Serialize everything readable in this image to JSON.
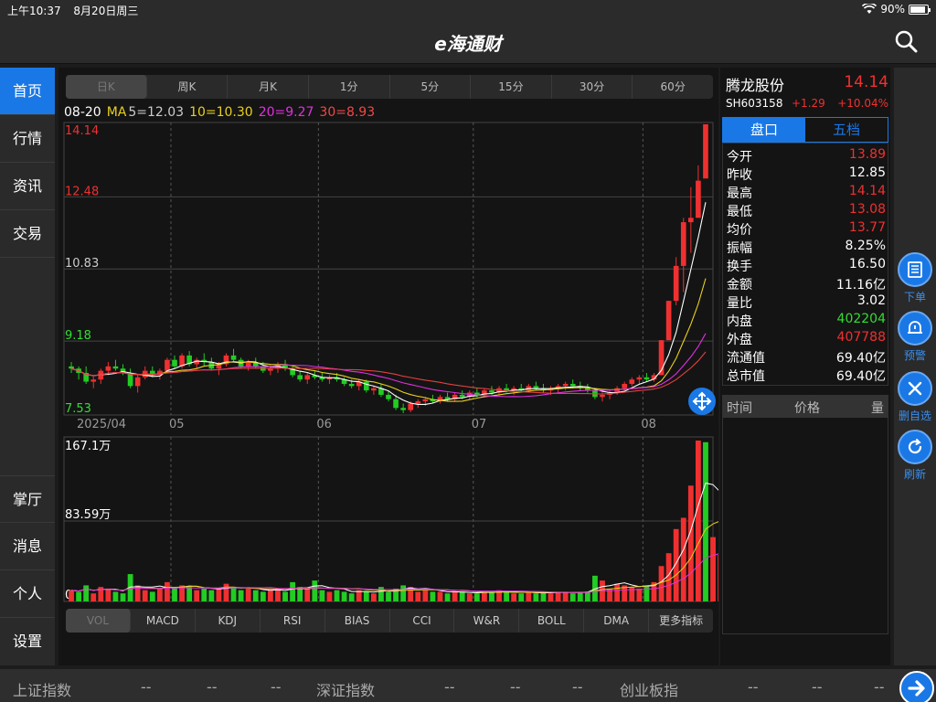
{
  "statusbar": {
    "time": "上午10:37",
    "date": "8月20日周三",
    "battery": "90%",
    "battery_level": 0.9
  },
  "app": {
    "title": "e海通财"
  },
  "leftnav": {
    "top_items": [
      {
        "label": "首页",
        "active": true
      },
      {
        "label": "行情",
        "active": false
      },
      {
        "label": "资讯",
        "active": false
      },
      {
        "label": "交易",
        "active": false
      }
    ],
    "bottom_items": [
      {
        "label": "掌厅"
      },
      {
        "label": "消息"
      },
      {
        "label": "个人"
      },
      {
        "label": "设置"
      }
    ]
  },
  "periods": [
    {
      "label": "日K",
      "active": true
    },
    {
      "label": "周K"
    },
    {
      "label": "月K"
    },
    {
      "label": "1分"
    },
    {
      "label": "5分"
    },
    {
      "label": "15分"
    },
    {
      "label": "30分"
    },
    {
      "label": "60分"
    }
  ],
  "ma_legend": {
    "date": "08-20",
    "ma": "MA",
    "ma5": "5=12.03",
    "ma10": "10=10.30",
    "ma20": "20=9.27",
    "ma30": "30=8.93"
  },
  "colors": {
    "up": "#f03030",
    "down": "#22cc22",
    "ma5": "#ffffff",
    "ma10": "#e8d020",
    "ma20": "#e030e0",
    "ma30": "#e04040",
    "accent": "#1a78e6",
    "label_green": "#33dd33"
  },
  "price_axis": {
    "labels": [
      "14.14",
      "12.48",
      "10.83",
      "9.18",
      "7.53"
    ]
  },
  "date_axis": {
    "labels": [
      "2025/04",
      "05",
      "06",
      "07",
      "08"
    ]
  },
  "volume_axis": {
    "labels": [
      "167.1万",
      "83.59万",
      "0"
    ]
  },
  "indicators": [
    {
      "label": "VOL",
      "active": true
    },
    {
      "label": "MACD"
    },
    {
      "label": "KDJ"
    },
    {
      "label": "RSI"
    },
    {
      "label": "BIAS"
    },
    {
      "label": "CCI"
    },
    {
      "label": "W&R"
    },
    {
      "label": "BOLL"
    },
    {
      "label": "DMA"
    },
    {
      "label": "更多指标"
    }
  ],
  "chart_data": {
    "type": "candlestick",
    "title": "",
    "price_range": [
      7.53,
      14.14
    ],
    "volume_range": [
      0,
      1671000
    ],
    "grid": true,
    "month_labels": [
      "2025/04",
      "05",
      "06",
      "07",
      "08"
    ],
    "candles": [
      [
        8.6,
        8.7,
        8.45,
        8.55
      ],
      [
        8.55,
        8.6,
        8.3,
        8.45
      ],
      [
        8.45,
        8.6,
        8.2,
        8.25
      ],
      [
        8.25,
        8.4,
        8.1,
        8.3
      ],
      [
        8.3,
        8.55,
        8.2,
        8.5
      ],
      [
        8.5,
        8.7,
        8.4,
        8.6
      ],
      [
        8.6,
        8.75,
        8.5,
        8.55
      ],
      [
        8.55,
        8.65,
        8.4,
        8.45
      ],
      [
        8.45,
        8.55,
        8.1,
        8.15
      ],
      [
        8.15,
        8.4,
        8.0,
        8.35
      ],
      [
        8.35,
        8.6,
        8.3,
        8.5
      ],
      [
        8.5,
        8.6,
        8.35,
        8.4
      ],
      [
        8.4,
        8.55,
        8.3,
        8.5
      ],
      [
        8.5,
        8.8,
        8.45,
        8.75
      ],
      [
        8.75,
        8.85,
        8.55,
        8.6
      ],
      [
        8.6,
        8.9,
        8.55,
        8.85
      ],
      [
        8.85,
        8.95,
        8.6,
        8.65
      ],
      [
        8.65,
        8.8,
        8.55,
        8.75
      ],
      [
        8.75,
        8.9,
        8.6,
        8.7
      ],
      [
        8.7,
        8.8,
        8.5,
        8.55
      ],
      [
        8.55,
        8.7,
        8.4,
        8.65
      ],
      [
        8.65,
        8.9,
        8.6,
        8.85
      ],
      [
        8.85,
        9.0,
        8.7,
        8.75
      ],
      [
        8.75,
        8.8,
        8.55,
        8.6
      ],
      [
        8.6,
        8.75,
        8.5,
        8.7
      ],
      [
        8.7,
        8.8,
        8.55,
        8.6
      ],
      [
        8.6,
        8.7,
        8.45,
        8.5
      ],
      [
        8.5,
        8.65,
        8.4,
        8.55
      ],
      [
        8.55,
        8.7,
        8.45,
        8.65
      ],
      [
        8.65,
        8.75,
        8.5,
        8.55
      ],
      [
        8.55,
        8.6,
        8.35,
        8.4
      ],
      [
        8.4,
        8.5,
        8.25,
        8.3
      ],
      [
        8.3,
        8.45,
        8.2,
        8.4
      ],
      [
        8.4,
        8.5,
        8.3,
        8.35
      ],
      [
        8.35,
        8.45,
        8.25,
        8.3
      ],
      [
        8.3,
        8.4,
        8.2,
        8.35
      ],
      [
        8.35,
        8.45,
        8.25,
        8.3
      ],
      [
        8.3,
        8.35,
        8.15,
        8.2
      ],
      [
        8.2,
        8.3,
        8.1,
        8.15
      ],
      [
        8.15,
        8.3,
        8.05,
        8.25
      ],
      [
        8.25,
        8.3,
        8.0,
        8.05
      ],
      [
        8.05,
        8.15,
        7.95,
        8.1
      ],
      [
        8.1,
        8.2,
        7.9,
        7.95
      ],
      [
        7.95,
        8.05,
        7.8,
        7.85
      ],
      [
        7.85,
        7.95,
        7.6,
        7.65
      ],
      [
        7.65,
        7.75,
        7.53,
        7.6
      ],
      [
        7.6,
        7.8,
        7.55,
        7.75
      ],
      [
        7.75,
        7.85,
        7.65,
        7.8
      ],
      [
        7.8,
        7.9,
        7.7,
        7.85
      ],
      [
        7.85,
        7.95,
        7.75,
        7.8
      ],
      [
        7.8,
        7.95,
        7.75,
        7.9
      ],
      [
        7.9,
        8.0,
        7.8,
        7.85
      ],
      [
        7.85,
        8.0,
        7.8,
        7.95
      ],
      [
        7.95,
        8.05,
        7.85,
        7.9
      ],
      [
        7.9,
        8.05,
        7.85,
        8.0
      ],
      [
        8.0,
        8.1,
        7.9,
        7.95
      ],
      [
        7.95,
        8.1,
        7.9,
        8.05
      ],
      [
        8.05,
        8.15,
        7.95,
        8.0
      ],
      [
        8.0,
        8.15,
        7.95,
        8.1
      ],
      [
        8.1,
        8.2,
        8.0,
        8.05
      ],
      [
        8.05,
        8.15,
        7.95,
        8.1
      ],
      [
        8.1,
        8.2,
        8.0,
        8.05
      ],
      [
        8.05,
        8.2,
        8.0,
        8.15
      ],
      [
        8.15,
        8.25,
        8.05,
        8.1
      ],
      [
        8.1,
        8.2,
        8.0,
        8.05
      ],
      [
        8.05,
        8.15,
        7.95,
        8.1
      ],
      [
        8.1,
        8.2,
        8.0,
        8.15
      ],
      [
        8.15,
        8.25,
        8.05,
        8.2
      ],
      [
        8.2,
        8.3,
        8.1,
        8.15
      ],
      [
        8.15,
        8.25,
        8.05,
        8.1
      ],
      [
        8.1,
        8.2,
        8.0,
        8.05
      ],
      [
        8.05,
        8.1,
        7.85,
        7.9
      ],
      [
        7.9,
        8.0,
        7.8,
        7.95
      ],
      [
        7.95,
        8.05,
        7.85,
        8.0
      ],
      [
        8.0,
        8.15,
        7.95,
        8.1
      ],
      [
        8.1,
        8.25,
        8.05,
        8.2
      ],
      [
        8.2,
        8.35,
        8.15,
        8.3
      ],
      [
        8.3,
        8.4,
        8.2,
        8.35
      ],
      [
        8.35,
        8.45,
        8.25,
        8.3
      ],
      [
        8.3,
        8.45,
        8.25,
        8.4
      ],
      [
        8.4,
        9.2,
        8.4,
        9.2
      ],
      [
        9.2,
        10.1,
        9.2,
        10.1
      ],
      [
        10.1,
        11.1,
        10.0,
        10.9
      ],
      [
        10.9,
        12.0,
        10.3,
        11.9
      ],
      [
        11.9,
        12.7,
        11.2,
        12.0
      ],
      [
        12.0,
        13.2,
        12.0,
        12.85
      ],
      [
        12.9,
        14.14,
        13.08,
        14.14
      ]
    ],
    "volumes": [
      [
        0.07,
        1
      ],
      [
        0.06,
        0
      ],
      [
        0.1,
        0
      ],
      [
        0.05,
        1
      ],
      [
        0.09,
        1
      ],
      [
        0.08,
        1
      ],
      [
        0.06,
        0
      ],
      [
        0.05,
        0
      ],
      [
        0.17,
        0
      ],
      [
        0.1,
        1
      ],
      [
        0.07,
        1
      ],
      [
        0.06,
        0
      ],
      [
        0.08,
        1
      ],
      [
        0.12,
        1
      ],
      [
        0.09,
        0
      ],
      [
        0.1,
        1
      ],
      [
        0.09,
        0
      ],
      [
        0.07,
        1
      ],
      [
        0.08,
        0
      ],
      [
        0.07,
        0
      ],
      [
        0.08,
        1
      ],
      [
        0.11,
        1
      ],
      [
        0.09,
        0
      ],
      [
        0.07,
        0
      ],
      [
        0.08,
        1
      ],
      [
        0.07,
        0
      ],
      [
        0.06,
        0
      ],
      [
        0.07,
        1
      ],
      [
        0.08,
        1
      ],
      [
        0.06,
        0
      ],
      [
        0.12,
        0
      ],
      [
        0.09,
        0
      ],
      [
        0.08,
        1
      ],
      [
        0.13,
        0
      ],
      [
        0.07,
        0
      ],
      [
        0.06,
        1
      ],
      [
        0.07,
        0
      ],
      [
        0.06,
        0
      ],
      [
        0.05,
        0
      ],
      [
        0.07,
        1
      ],
      [
        0.06,
        0
      ],
      [
        0.05,
        1
      ],
      [
        0.09,
        0
      ],
      [
        0.06,
        0
      ],
      [
        0.08,
        0
      ],
      [
        0.1,
        0
      ],
      [
        0.09,
        1
      ],
      [
        0.06,
        1
      ],
      [
        0.07,
        1
      ],
      [
        0.06,
        0
      ],
      [
        0.06,
        1
      ],
      [
        0.05,
        0
      ],
      [
        0.06,
        1
      ],
      [
        0.06,
        0
      ],
      [
        0.05,
        1
      ],
      [
        0.05,
        0
      ],
      [
        0.06,
        1
      ],
      [
        0.06,
        0
      ],
      [
        0.07,
        1
      ],
      [
        0.06,
        0
      ],
      [
        0.05,
        1
      ],
      [
        0.05,
        0
      ],
      [
        0.06,
        1
      ],
      [
        0.05,
        0
      ],
      [
        0.06,
        0
      ],
      [
        0.05,
        1
      ],
      [
        0.06,
        1
      ],
      [
        0.06,
        1
      ],
      [
        0.05,
        0
      ],
      [
        0.06,
        0
      ],
      [
        0.06,
        0
      ],
      [
        0.16,
        0
      ],
      [
        0.13,
        1
      ],
      [
        0.08,
        1
      ],
      [
        0.11,
        1
      ],
      [
        0.1,
        1
      ],
      [
        0.09,
        1
      ],
      [
        0.08,
        1
      ],
      [
        0.1,
        0
      ],
      [
        0.12,
        1
      ],
      [
        0.22,
        1
      ],
      [
        0.3,
        1
      ],
      [
        0.45,
        1
      ],
      [
        0.52,
        1
      ],
      [
        0.72,
        1
      ],
      [
        1.0,
        1
      ],
      [
        0.99,
        0
      ],
      [
        0.4,
        1
      ],
      [
        0.29,
        1
      ]
    ]
  },
  "stock": {
    "name": "腾龙股份",
    "price": "14.14",
    "code": "SH603158",
    "change": "+1.29",
    "pct": "+10.04%"
  },
  "info_tabs": [
    {
      "label": "盘口",
      "active": true
    },
    {
      "label": "五档",
      "active": false
    }
  ],
  "quote": [
    {
      "k": "今开",
      "v": "13.89",
      "c": "red"
    },
    {
      "k": "昨收",
      "v": "12.85",
      "c": "white"
    },
    {
      "k": "最高",
      "v": "14.14",
      "c": "red"
    },
    {
      "k": "最低",
      "v": "13.08",
      "c": "red"
    },
    {
      "k": "均价",
      "v": "13.77",
      "c": "red"
    },
    {
      "k": "振幅",
      "v": "8.25%",
      "c": "white"
    },
    {
      "k": "换手",
      "v": "16.50",
      "c": "white"
    },
    {
      "k": "金额",
      "v": "11.16亿",
      "c": "white"
    },
    {
      "k": "量比",
      "v": "3.02",
      "c": "white"
    },
    {
      "k": "内盘",
      "v": "402204",
      "c": "green"
    },
    {
      "k": "外盘",
      "v": "407788",
      "c": "red"
    },
    {
      "k": "流通值",
      "v": "69.40亿",
      "c": "white"
    },
    {
      "k": "总市值",
      "v": "69.40亿",
      "c": "white"
    }
  ],
  "trades_header": {
    "time": "时间",
    "price": "价格",
    "volume": "量"
  },
  "actions": [
    {
      "label": "下单",
      "icon": "order-icon"
    },
    {
      "label": "预警",
      "icon": "alert-bell-icon"
    },
    {
      "label": "删自选",
      "icon": "close-icon"
    },
    {
      "label": "刷新",
      "icon": "refresh-icon"
    }
  ],
  "ticker": {
    "sh": "上证指数",
    "sz": "深证指数",
    "cy": "创业板指",
    "dash": "--"
  }
}
